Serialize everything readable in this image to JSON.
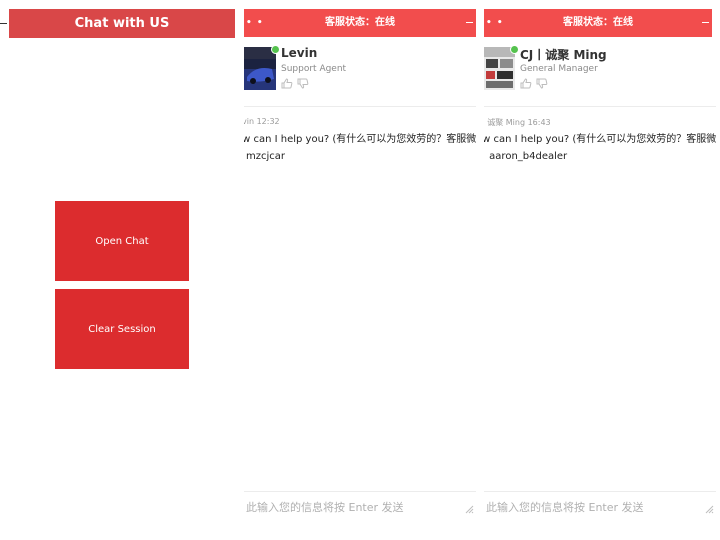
{
  "launcher": {
    "title": "Chat with US",
    "open_chat_label": "Open Chat",
    "clear_session_label": "Clear Session",
    "accent": "#dc2c2e"
  },
  "chat_windows": [
    {
      "header_status": "客服状态：在线",
      "agent_name": "Levin",
      "agent_role": "Support Agent",
      "message_meta": "vin 12:32",
      "message_line1": "ow can I help you? (有什么可以为您效劳的？客服微",
      "message_line2": "：mzcjcar",
      "input_placeholder": "此输入您的信息将按 Enter 发送",
      "header_color": "#f24d4d"
    },
    {
      "header_status": "客服状态：在线",
      "agent_name": "CJ丨诚聚 Ming",
      "agent_role": "General Manager",
      "message_meta": "| 诚聚 Ming 16:43",
      "message_line1": "ow can I help you? (有什么可以为您效劳的？客服微",
      "message_line2": "： aaron_b4dealer",
      "input_placeholder": "此输入您的信息将按 Enter 发送",
      "header_color": "#f24d4d"
    }
  ],
  "icons": [
    "minimize-icon",
    "online-status-icon",
    "thumbs-up-icon",
    "thumbs-down-icon",
    "resize-handle-icon"
  ]
}
